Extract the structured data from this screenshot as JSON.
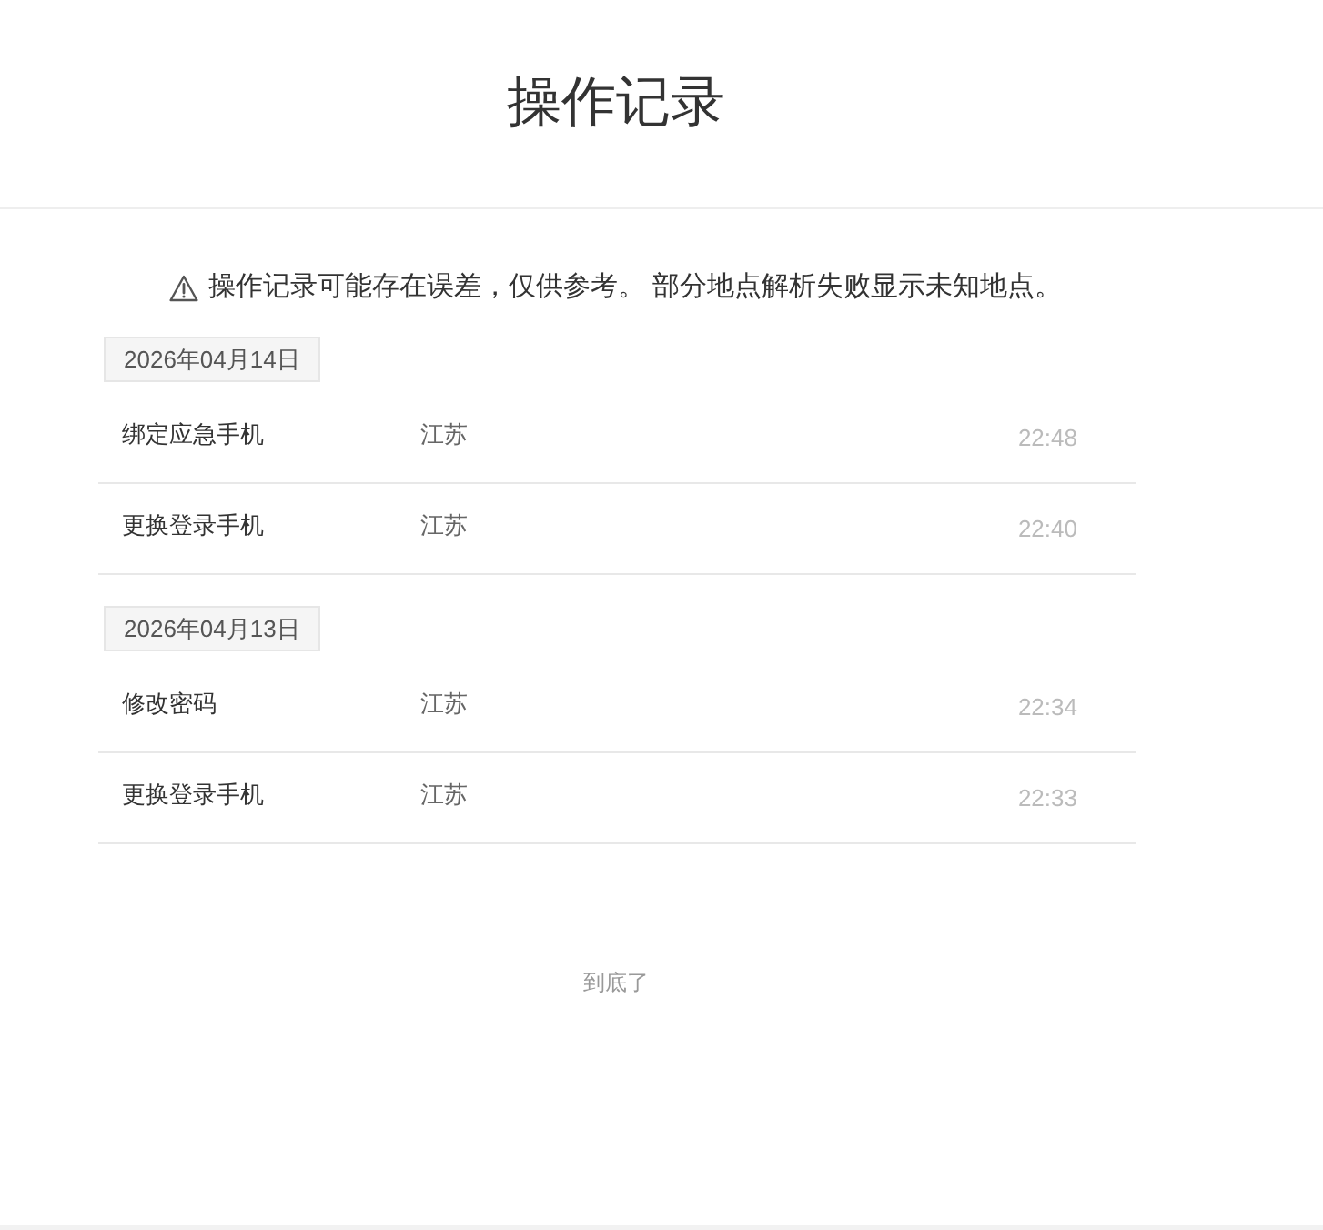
{
  "page": {
    "title": "操作记录"
  },
  "notice": {
    "text": "操作记录可能存在误差，仅供参考。 部分地点解析失败显示未知地点。"
  },
  "groups": [
    {
      "date": "2026年04月14日",
      "records": [
        {
          "action": "绑定应急手机",
          "location": "江苏",
          "time": "22:48"
        },
        {
          "action": "更换登录手机",
          "location": "江苏",
          "time": "22:40"
        }
      ]
    },
    {
      "date": "2026年04月13日",
      "records": [
        {
          "action": "修改密码",
          "location": "江苏",
          "time": "22:34"
        },
        {
          "action": "更换登录手机",
          "location": "江苏",
          "time": "22:33"
        }
      ]
    }
  ],
  "footer": {
    "text": "到底了"
  }
}
